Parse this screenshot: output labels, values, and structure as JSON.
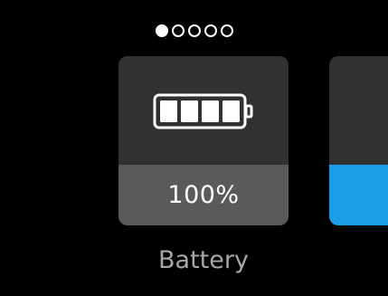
{
  "pager": {
    "total_pages": 5,
    "current_page": 1
  },
  "battery_card": {
    "level_percent_text": "100%",
    "level_fraction": 1.0,
    "icon": "battery-full-icon",
    "label": "Battery"
  },
  "next_card": {
    "accent_color": "#1a9ee8"
  },
  "colors": {
    "background": "#000000",
    "card_top": "#313131",
    "card_bottom": "#5a5a5a",
    "label_text": "#a7a7a7",
    "accent_blue": "#1a9ee8"
  }
}
